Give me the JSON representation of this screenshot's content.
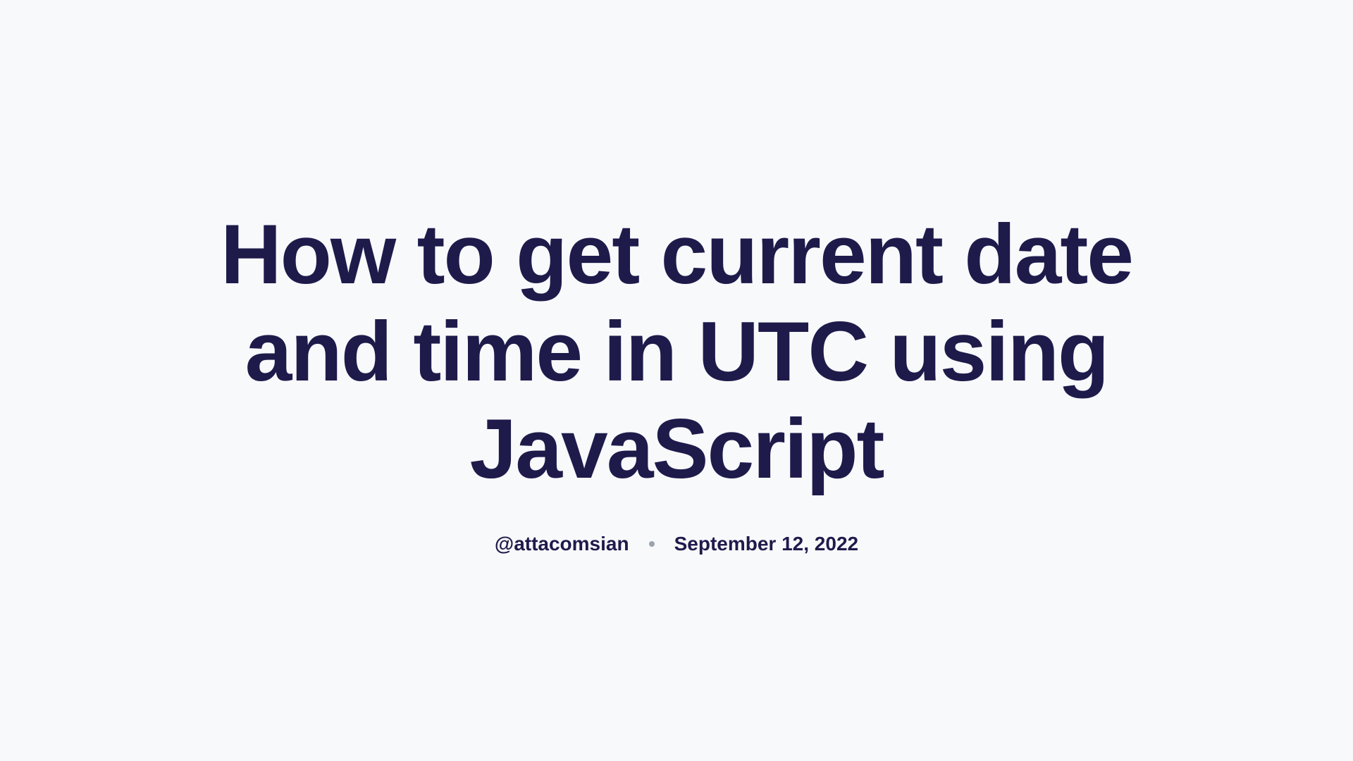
{
  "article": {
    "title": "How to get current date and time in UTC using JavaScript",
    "author": "@attacomsian",
    "date": "September 12, 2022"
  }
}
